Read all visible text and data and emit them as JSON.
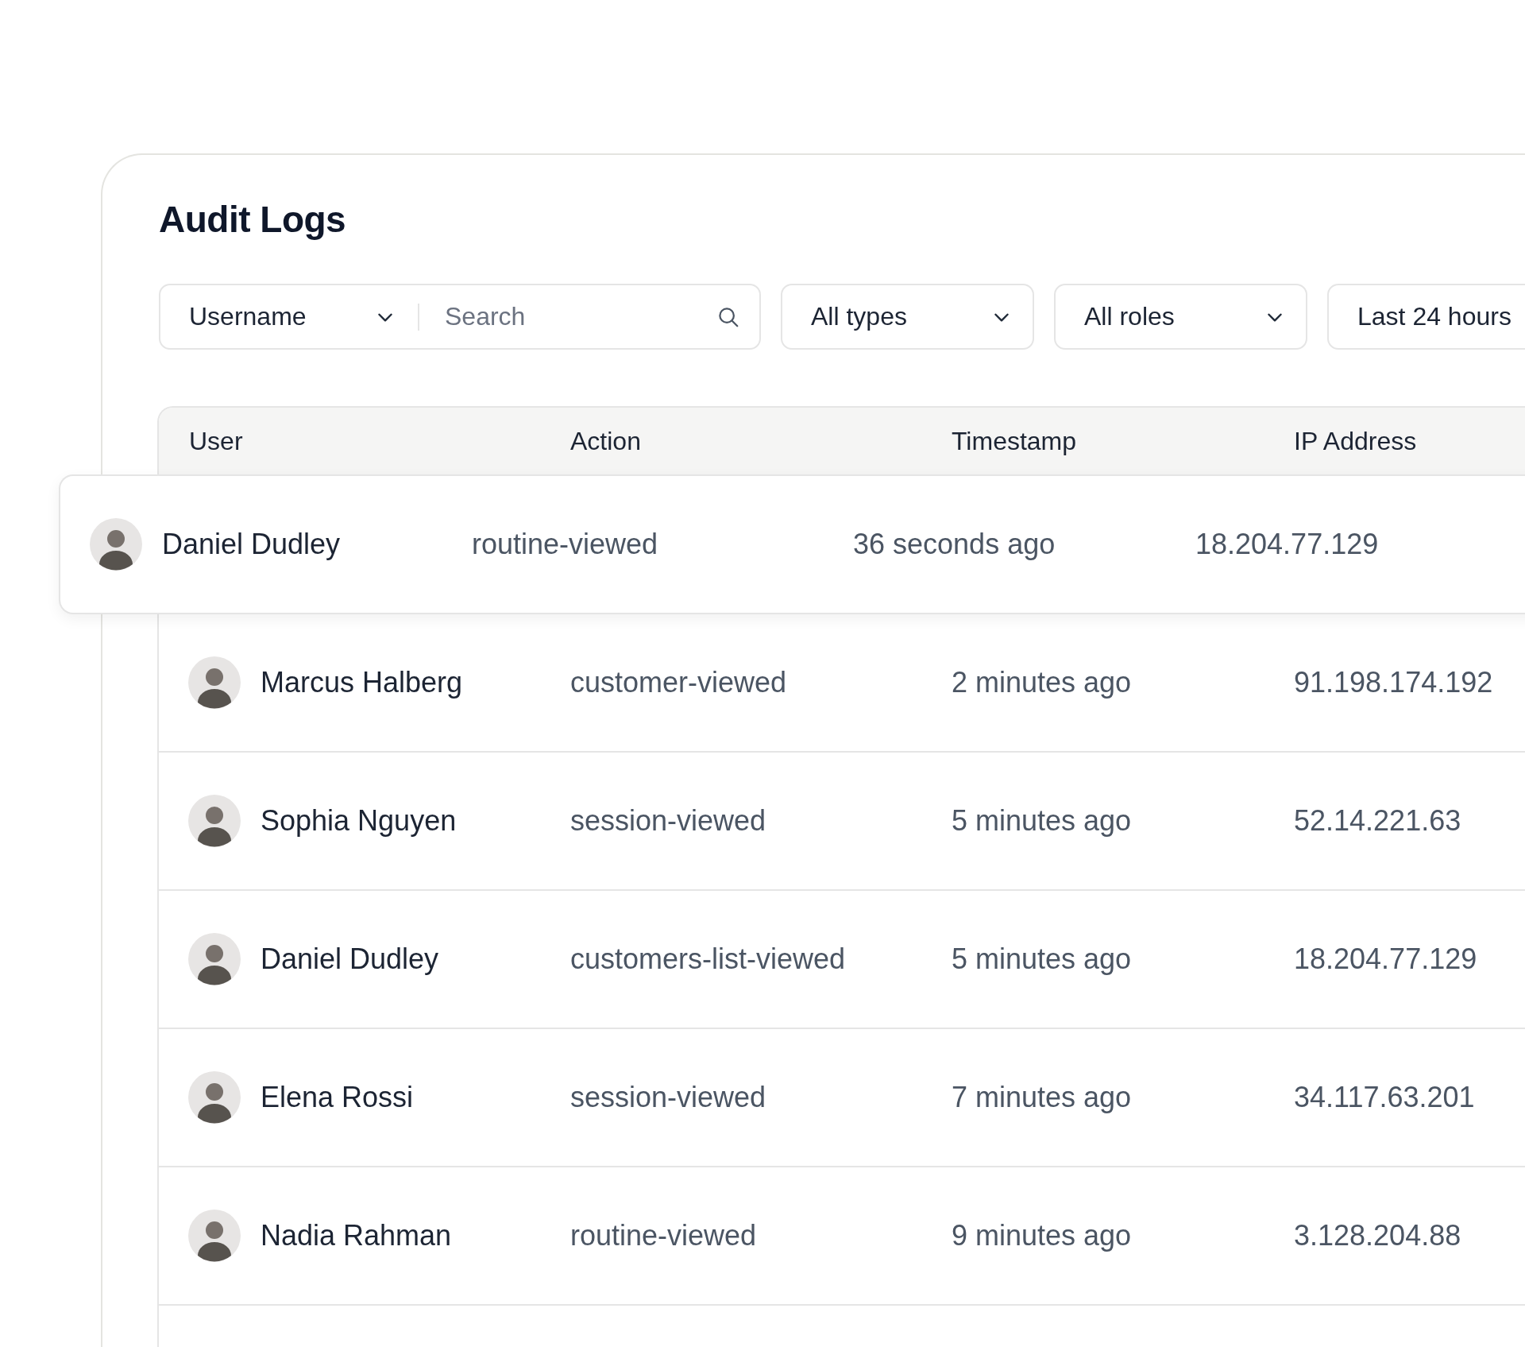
{
  "title": "Audit Logs",
  "filters": {
    "search": {
      "field": "Username",
      "placeholder": "Search"
    },
    "dropdowns": [
      {
        "label": "All types"
      },
      {
        "label": "All roles"
      },
      {
        "label": "Last 24 hours"
      }
    ]
  },
  "table": {
    "columns": [
      "User",
      "Action",
      "Timestamp",
      "IP Address"
    ],
    "rows": [
      {
        "user": "Daniel Dudley",
        "action": "routine-viewed",
        "timestamp": "36 seconds ago",
        "ip": "18.204.77.129",
        "selected": true
      },
      {
        "user": "Marcus Halberg",
        "action": "customer-viewed",
        "timestamp": "2 minutes ago",
        "ip": "91.198.174.192",
        "selected": false
      },
      {
        "user": "Sophia Nguyen",
        "action": "session-viewed",
        "timestamp": "5 minutes ago",
        "ip": "52.14.221.63",
        "selected": false
      },
      {
        "user": "Daniel Dudley",
        "action": "customers-list-viewed",
        "timestamp": "5 minutes ago",
        "ip": "18.204.77.129",
        "selected": false
      },
      {
        "user": "Elena Rossi",
        "action": "session-viewed",
        "timestamp": "7 minutes ago",
        "ip": "34.117.63.201",
        "selected": false
      },
      {
        "user": "Nadia Rahman",
        "action": "routine-viewed",
        "timestamp": "9 minutes ago",
        "ip": "3.128.204.88",
        "selected": false
      }
    ]
  }
}
